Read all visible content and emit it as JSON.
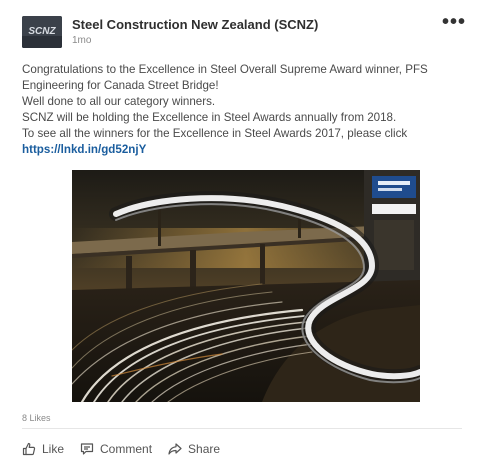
{
  "post": {
    "author": {
      "name": "Steel Construction New Zealand (SCNZ)",
      "time": "1mo",
      "logo_text": "SCNZ"
    },
    "more_label": "•••",
    "body_lines": [
      "Congratulations to the Excellence in Steel Overall Supreme Award winner, PFS",
      "Engineering for Canada Street Bridge!",
      "Well done to all our category winners.",
      "SCNZ will be holding the Excellence in Steel Awards annually from 2018.",
      "To see all the winners for the Excellence in Steel Awards 2017, please click"
    ],
    "link": "https://lnkd.in/gd52njY",
    "likes": "8 Likes",
    "actions": {
      "like": "Like",
      "comment": "Comment",
      "share": "Share"
    },
    "icons": {
      "like": "thumbs-up-icon",
      "comment": "comment-icon",
      "share": "share-arrow-icon",
      "more": "ellipsis-icon"
    }
  }
}
